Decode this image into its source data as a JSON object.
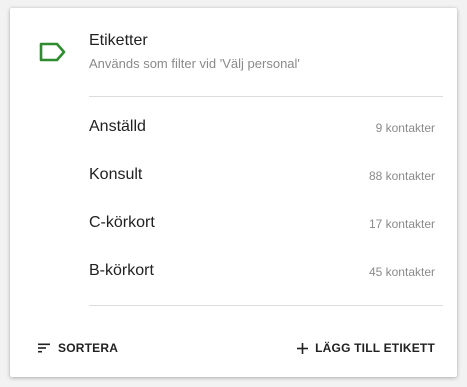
{
  "header": {
    "icon": "tag-icon",
    "title": "Etiketter",
    "subtitle": "Används som filter vid 'Välj personal'",
    "accent_color": "#2e8b2e"
  },
  "labels": [
    {
      "name": "Anställd",
      "count": "9 kontakter"
    },
    {
      "name": "Konsult",
      "count": "88 kontakter"
    },
    {
      "name": "C-körkort",
      "count": "17 kontakter"
    },
    {
      "name": "B-körkort",
      "count": "45 kontakter"
    }
  ],
  "footer": {
    "sort_label": "SORTERA",
    "sort_icon": "sort-icon",
    "add_label": "LÄGG TILL ETIKETT",
    "add_icon": "plus-icon"
  }
}
